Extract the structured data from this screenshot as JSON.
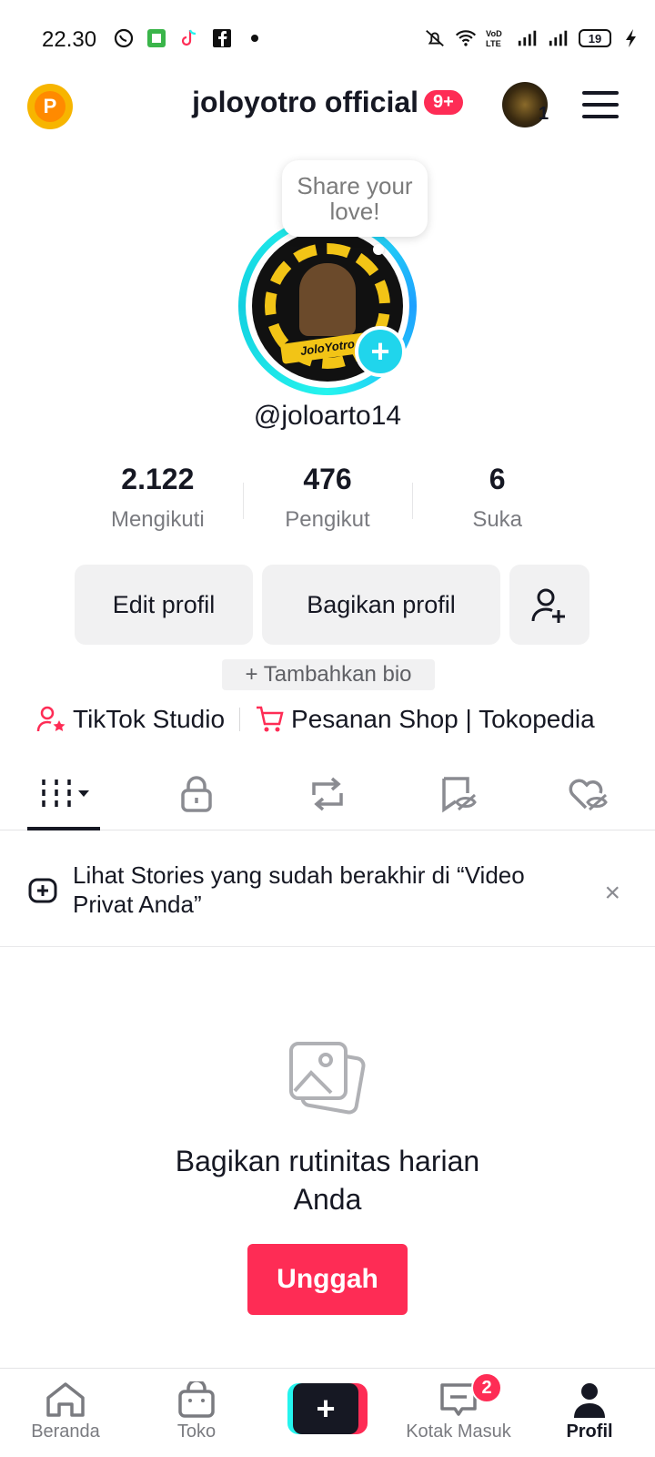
{
  "status_bar": {
    "time": "22.30",
    "battery": "19",
    "volte_label": "VoLTE"
  },
  "header": {
    "coin_letter": "P",
    "title": "joloyotro official",
    "notification_badge": "9+",
    "mini_avatar_count": "1"
  },
  "profile": {
    "bubble_text": "Share your love!",
    "avatar_banner": "JoloYotro",
    "username": "@joloarto14",
    "stats": [
      {
        "value": "2.122",
        "label": "Mengikuti"
      },
      {
        "value": "476",
        "label": "Pengikut"
      },
      {
        "value": "6",
        "label": "Suka"
      }
    ],
    "edit_button": "Edit profil",
    "share_button": "Bagikan profil",
    "bio_button": "+ Tambahkan bio",
    "links": {
      "studio": "TikTok Studio",
      "shop": "Pesanan Shop | Tokopedia"
    }
  },
  "tabs": [
    "grid-icon",
    "lock-icon",
    "repost-icon",
    "saved-icon",
    "liked-icon"
  ],
  "stories_banner": {
    "text": "Lihat Stories yang sudah berakhir di “Video Privat Anda”",
    "close": "×"
  },
  "empty_state": {
    "text_line1": "Bagikan rutinitas harian",
    "text_line2": "Anda",
    "upload_button": "Unggah"
  },
  "bottom_nav": {
    "home": "Beranda",
    "shop": "Toko",
    "create": "+",
    "inbox": "Kotak Masuk",
    "inbox_badge": "2",
    "profile": "Profil"
  },
  "colors": {
    "accent": "#fe2c55",
    "cyan": "#25f4ee",
    "text": "#161823"
  }
}
